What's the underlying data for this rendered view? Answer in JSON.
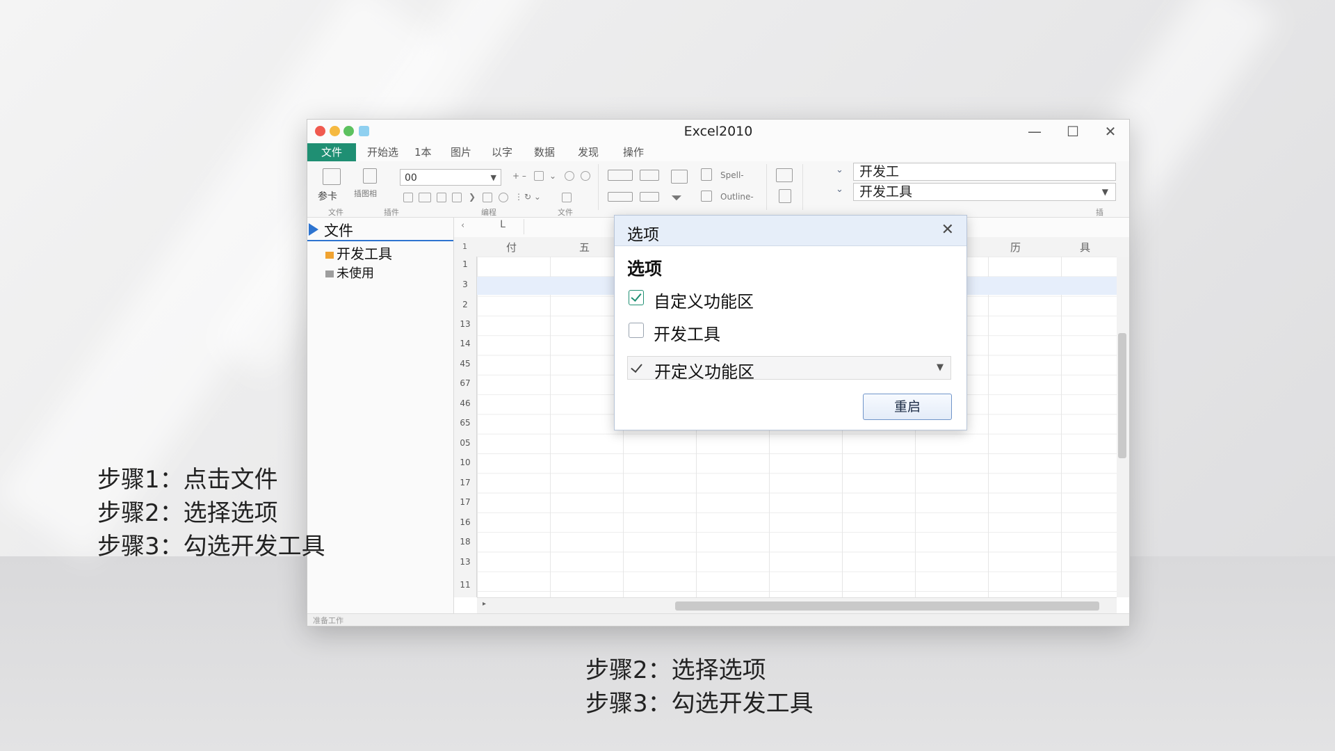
{
  "window": {
    "title": "Excel2010",
    "controls": {
      "minimize": "—",
      "maximize": "☐",
      "close": "✕"
    }
  },
  "menu": {
    "active": "文件",
    "items": [
      "开始选",
      "1本",
      "图片",
      "以字",
      "数据",
      "发现",
      "操作"
    ]
  },
  "ribbon": {
    "combo_value": "00",
    "icon_text": [
      "参卡",
      "插图相"
    ],
    "text_items": [
      "Spell-",
      "Outline-"
    ],
    "group_labels": [
      "文件",
      "插件",
      "编程",
      "文件",
      "插"
    ],
    "field_top": "开发工",
    "field_bottom": "开发工具"
  },
  "sidebar": {
    "header": "文件",
    "items": [
      {
        "label": "开发工具",
        "icon_color": "#f0a331"
      },
      {
        "label": "未使用",
        "icon_color": "#9e9e9e"
      }
    ]
  },
  "grid": {
    "name_box": "L",
    "corner": "1",
    "columns": [
      "付",
      "五",
      "历",
      "具"
    ],
    "rows": [
      "1",
      "3",
      "2",
      "13",
      "14",
      "45",
      "67",
      "46",
      "65",
      "05",
      "10",
      "17",
      "17",
      "16",
      "18",
      "13",
      "11"
    ],
    "status_text": "准备工作"
  },
  "dialog": {
    "title": "选项",
    "close": "✕",
    "heading": "选项",
    "options": [
      {
        "label": "自定义功能区",
        "checked": true
      },
      {
        "label": "开发工具",
        "checked": false
      }
    ],
    "select_label": "开定义功能区",
    "button": "重启"
  },
  "captions": {
    "left": [
      "步骤1：点击文件",
      "步骤2：选择选项",
      "步骤3：勾选开发工具"
    ],
    "bottom": [
      "步骤2：选择选项",
      "步骤3：勾选开发工具"
    ]
  },
  "colors": {
    "accent": "#1f8f73",
    "selection": "#2d74d0",
    "close_dot": "#f05a4f",
    "min_dot": "#f5b941",
    "max_dot": "#5cc15f",
    "extra_dot": "#8fd0f0"
  }
}
